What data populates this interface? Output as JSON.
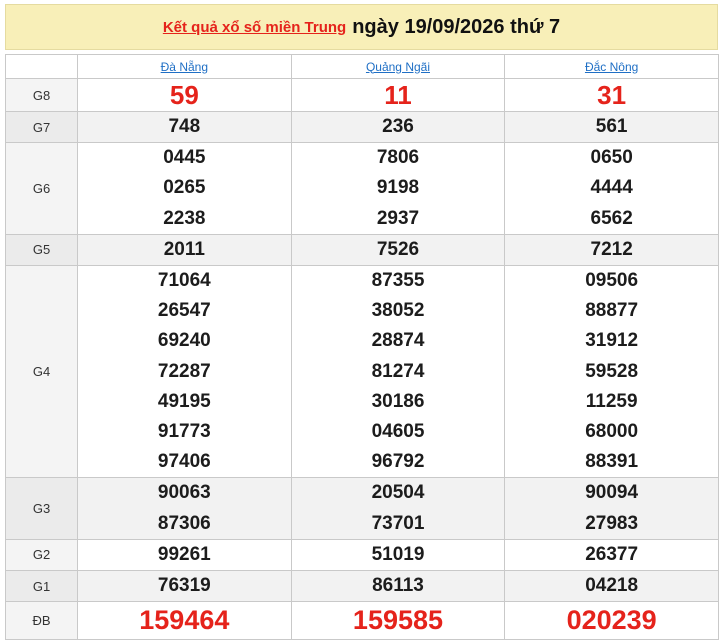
{
  "header": {
    "link_text": "Kết quả xổ số miền Trung",
    "date_text": "ngày 19/09/2026 thứ 7"
  },
  "provinces": [
    "Đà Nẵng",
    "Quảng Ngãi",
    "Đắc Nông"
  ],
  "rows": [
    {
      "label": "G8",
      "values": [
        [
          "59"
        ],
        [
          "11"
        ],
        [
          "31"
        ]
      ]
    },
    {
      "label": "G7",
      "values": [
        [
          "748"
        ],
        [
          "236"
        ],
        [
          "561"
        ]
      ]
    },
    {
      "label": "G6",
      "values": [
        [
          "0445",
          "0265",
          "2238"
        ],
        [
          "7806",
          "9198",
          "2937"
        ],
        [
          "0650",
          "4444",
          "6562"
        ]
      ]
    },
    {
      "label": "G5",
      "values": [
        [
          "2011"
        ],
        [
          "7526"
        ],
        [
          "7212"
        ]
      ]
    },
    {
      "label": "G4",
      "values": [
        [
          "71064",
          "26547",
          "69240",
          "72287",
          "49195",
          "91773",
          "97406"
        ],
        [
          "87355",
          "38052",
          "28874",
          "81274",
          "30186",
          "04605",
          "96792"
        ],
        [
          "09506",
          "88877",
          "31912",
          "59528",
          "11259",
          "68000",
          "88391"
        ]
      ]
    },
    {
      "label": "G3",
      "values": [
        [
          "90063",
          "87306"
        ],
        [
          "20504",
          "73701"
        ],
        [
          "90094",
          "27983"
        ]
      ]
    },
    {
      "label": "G2",
      "values": [
        [
          "99261"
        ],
        [
          "51019"
        ],
        [
          "26377"
        ]
      ]
    },
    {
      "label": "G1",
      "values": [
        [
          "76319"
        ],
        [
          "86113"
        ],
        [
          "04218"
        ]
      ]
    },
    {
      "label": "ĐB",
      "values": [
        [
          "159464"
        ],
        [
          "159585"
        ],
        [
          "020239"
        ]
      ]
    }
  ],
  "colors": {
    "header_bg": "#f8efb8",
    "accent_red": "#e5231b",
    "link_blue": "#1f6fc5",
    "alt_row_bg": "#f2f2f2"
  }
}
